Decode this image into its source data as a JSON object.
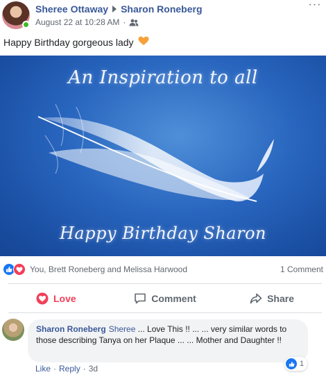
{
  "post": {
    "author": "Sheree Ottaway",
    "target": "Sharon Roneberg",
    "timestamp": "August 22 at 10:28 AM",
    "separator": "·",
    "privacy_icon": "friends-icon",
    "more_label": "···",
    "text": "Happy Birthday gorgeous lady",
    "text_emoji": "orange-heart-icon"
  },
  "image": {
    "top_text": "An Inspiration to all",
    "bottom_text": "Happy Birthday Sharon",
    "background_color": "#2966bf"
  },
  "reactions": {
    "icons": [
      "like-icon",
      "love-icon"
    ],
    "names": "You, Brett Roneberg and Melissa Harwood",
    "comments": "1 Comment"
  },
  "actions": {
    "love": "Love",
    "comment": "Comment",
    "share": "Share",
    "love_color": "#f33e58"
  },
  "comment": {
    "author": "Sharon Roneberg",
    "mention": "Sheree",
    "text": " ... Love This !! ... ... very similar words to those describing Tanya on her Plaque ... ... Mother and Daughter !!",
    "like_count": "1",
    "like_label": "Like",
    "reply_label": "Reply",
    "separator": "·",
    "age": "3d"
  },
  "colors": {
    "link_blue": "#385898",
    "like_blue": "#1877f2",
    "online_green": "#42b72a"
  }
}
